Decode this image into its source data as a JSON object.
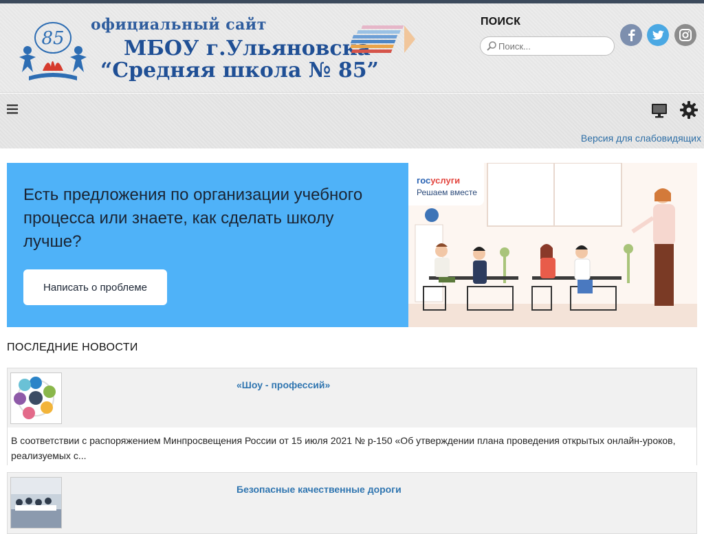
{
  "header": {
    "site_small": "официальный сайт",
    "site_line1": "МБОУ г.Ульяновска",
    "site_line2": "“Средняя школа № 85”",
    "logo_number": "85",
    "search_label": "ПОИСК",
    "search_placeholder": "Поиск...",
    "social": [
      "facebook-icon",
      "twitter-icon",
      "instagram-icon"
    ]
  },
  "navbar": {
    "menu_icon": "hamburger-icon",
    "monitor_icon": "monitor-icon",
    "settings_icon": "gear-icon",
    "low_vision_link": "Версия для слабовидящих"
  },
  "banner": {
    "text": "Есть предложения по организации учебного процесса или знаете, как сделать школу лучше?",
    "button": "Написать о проблеме",
    "gos_logo_a": "гос",
    "gos_logo_b": "услуги",
    "gos_sub": "Решаем вместе",
    "colors": {
      "left_bg": "#4fb2f8",
      "right_bg": "#fdf6f1"
    }
  },
  "news": {
    "title": "ПОСЛЕДНИЕ НОВОСТИ",
    "items": [
      {
        "title": "«Шоу - профессий»",
        "excerpt": "В соответствии с распоряжением Минпросвещения России от 15 июля 2021 № р-150 «Об утверждении плана проведения открытых онлайн-уроков, реализуемых с..."
      },
      {
        "title": "Безопасные качественные дороги",
        "excerpt": ""
      }
    ]
  },
  "colors": {
    "link": "#2f75b0",
    "title_blue": "#1f4f95"
  }
}
